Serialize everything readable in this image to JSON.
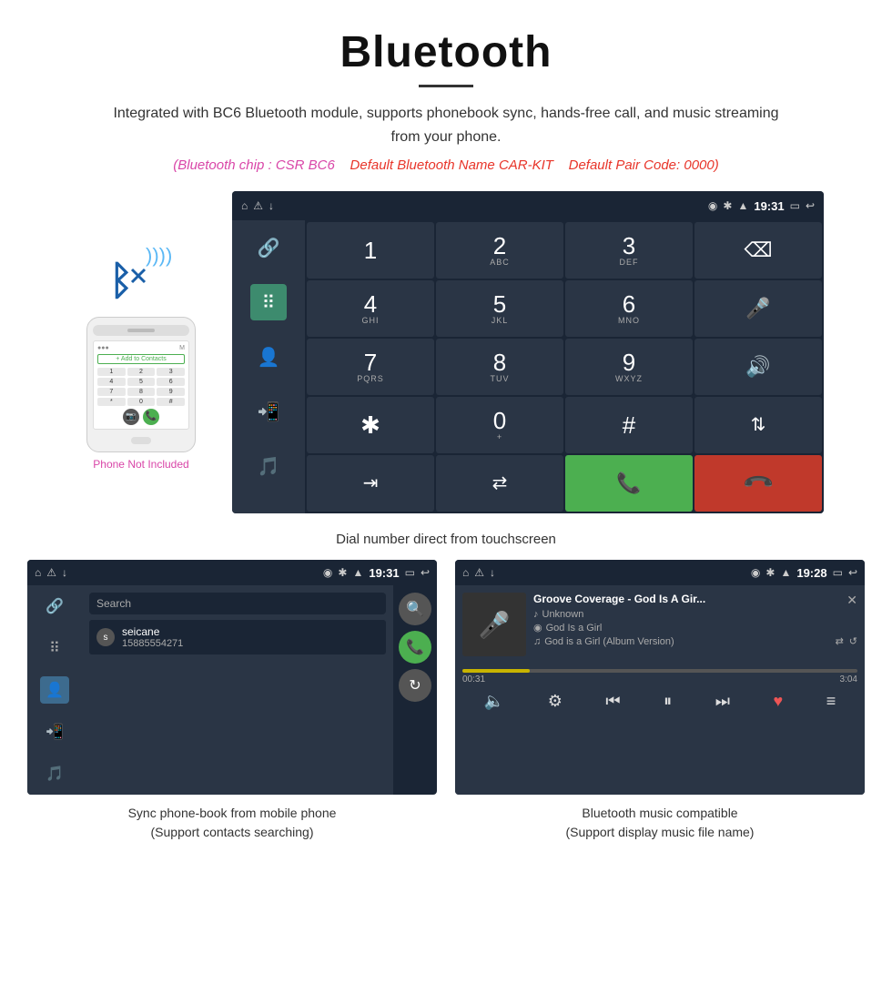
{
  "header": {
    "title": "Bluetooth",
    "description": "Integrated with BC6 Bluetooth module, supports phonebook sync, hands-free call, and music streaming from your phone.",
    "spec_chip": "(Bluetooth chip : CSR BC6",
    "spec_name": "Default Bluetooth Name CAR-KIT",
    "spec_code": "Default Pair Code: 0000)",
    "underline": true
  },
  "phone_side": {
    "not_included": "Phone Not Included",
    "add_contacts": "+ Add to Contacts",
    "dial_keys": [
      "1",
      "2",
      "3",
      "4",
      "5",
      "6",
      "7",
      "8",
      "9",
      "*",
      "0",
      "#"
    ]
  },
  "car_screen": {
    "status_bar": {
      "left_icons": [
        "⌂",
        "⚠",
        "↓"
      ],
      "right_icons": [
        "◉",
        "✱",
        "▲"
      ],
      "time": "19:31",
      "battery": "▭",
      "back": "↩"
    },
    "dial_keys": [
      {
        "main": "1",
        "sub": ""
      },
      {
        "main": "2",
        "sub": "ABC"
      },
      {
        "main": "3",
        "sub": "DEF"
      },
      {
        "main": "⌫",
        "sub": ""
      },
      {
        "main": "4",
        "sub": "GHI"
      },
      {
        "main": "5",
        "sub": "JKL"
      },
      {
        "main": "6",
        "sub": "MNO"
      },
      {
        "main": "🎤",
        "sub": ""
      },
      {
        "main": "7",
        "sub": "PQRS"
      },
      {
        "main": "8",
        "sub": "TUV"
      },
      {
        "main": "9",
        "sub": "WXYZ"
      },
      {
        "main": "🔊",
        "sub": ""
      },
      {
        "main": "✱",
        "sub": ""
      },
      {
        "main": "0",
        "sub": "+"
      },
      {
        "main": "#",
        "sub": ""
      },
      {
        "main": "⇅",
        "sub": ""
      },
      {
        "main": "⇥",
        "sub": ""
      },
      {
        "main": "⇄",
        "sub": ""
      },
      {
        "main": "📞",
        "sub": ""
      },
      {
        "main": "📞",
        "sub": "end"
      }
    ],
    "caption": "Dial number direct from touchscreen"
  },
  "phonebook_screen": {
    "status": {
      "left": [
        "⌂",
        "⚠",
        "↓"
      ],
      "right_icons": [
        "◉",
        "✱",
        "▲"
      ],
      "time": "19:31",
      "battery": "▭",
      "back": "↩"
    },
    "search_placeholder": "Search",
    "contact": {
      "letter": "s",
      "name": "seicane",
      "number": "15885554271"
    },
    "caption_line1": "Sync phone-book from mobile phone",
    "caption_line2": "(Support contacts searching)"
  },
  "music_screen": {
    "status": {
      "left": [
        "⌂",
        "⚠",
        "↓"
      ],
      "right_icons": [
        "◉",
        "✱",
        "▲"
      ],
      "time": "19:28",
      "battery": "▭",
      "back": "↩"
    },
    "song_title": "Groove Coverage - God Is A Gir...",
    "artist": "Unknown",
    "album": "God Is a Girl",
    "full_title": "God is a Girl (Album Version)",
    "progress_current": "00:31",
    "progress_total": "3:04",
    "progress_percent": 17,
    "caption_line1": "Bluetooth music compatible",
    "caption_line2": "(Support display music file name)"
  },
  "icons": {
    "link": "🔗",
    "dialpad": "⠿",
    "person": "👤",
    "transfer": "📲",
    "music": "🎵",
    "microphone": "🎤",
    "volume": "🔊",
    "phone_call": "📞",
    "back_space": "⌫",
    "shuffle": "⇄",
    "bluetooth": "ᛒ",
    "signal_waves": ")))",
    "search": "🔍",
    "refresh": "↻",
    "heart": "♥",
    "list": "≡",
    "prev": "⏮",
    "play_pause": "⏸",
    "next": "⏭",
    "eq": "⚙",
    "volume_ctrl": "🔈"
  }
}
